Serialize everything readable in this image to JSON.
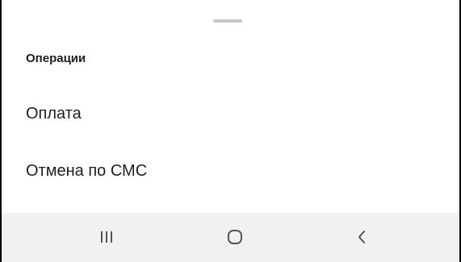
{
  "sheet": {
    "title": "Операции",
    "items": [
      {
        "label": "Оплата"
      },
      {
        "label": "Отмена по СМС"
      }
    ]
  },
  "nav_bar": {
    "buttons": [
      {
        "icon": "recents-icon"
      },
      {
        "icon": "home-icon"
      },
      {
        "icon": "back-icon"
      }
    ]
  },
  "colors": {
    "background": "#ffffff",
    "text": "#1f1f1f",
    "handle": "#c8c8c8",
    "nav_bar": "#f1f1f1",
    "nav_icon": "#555555"
  }
}
